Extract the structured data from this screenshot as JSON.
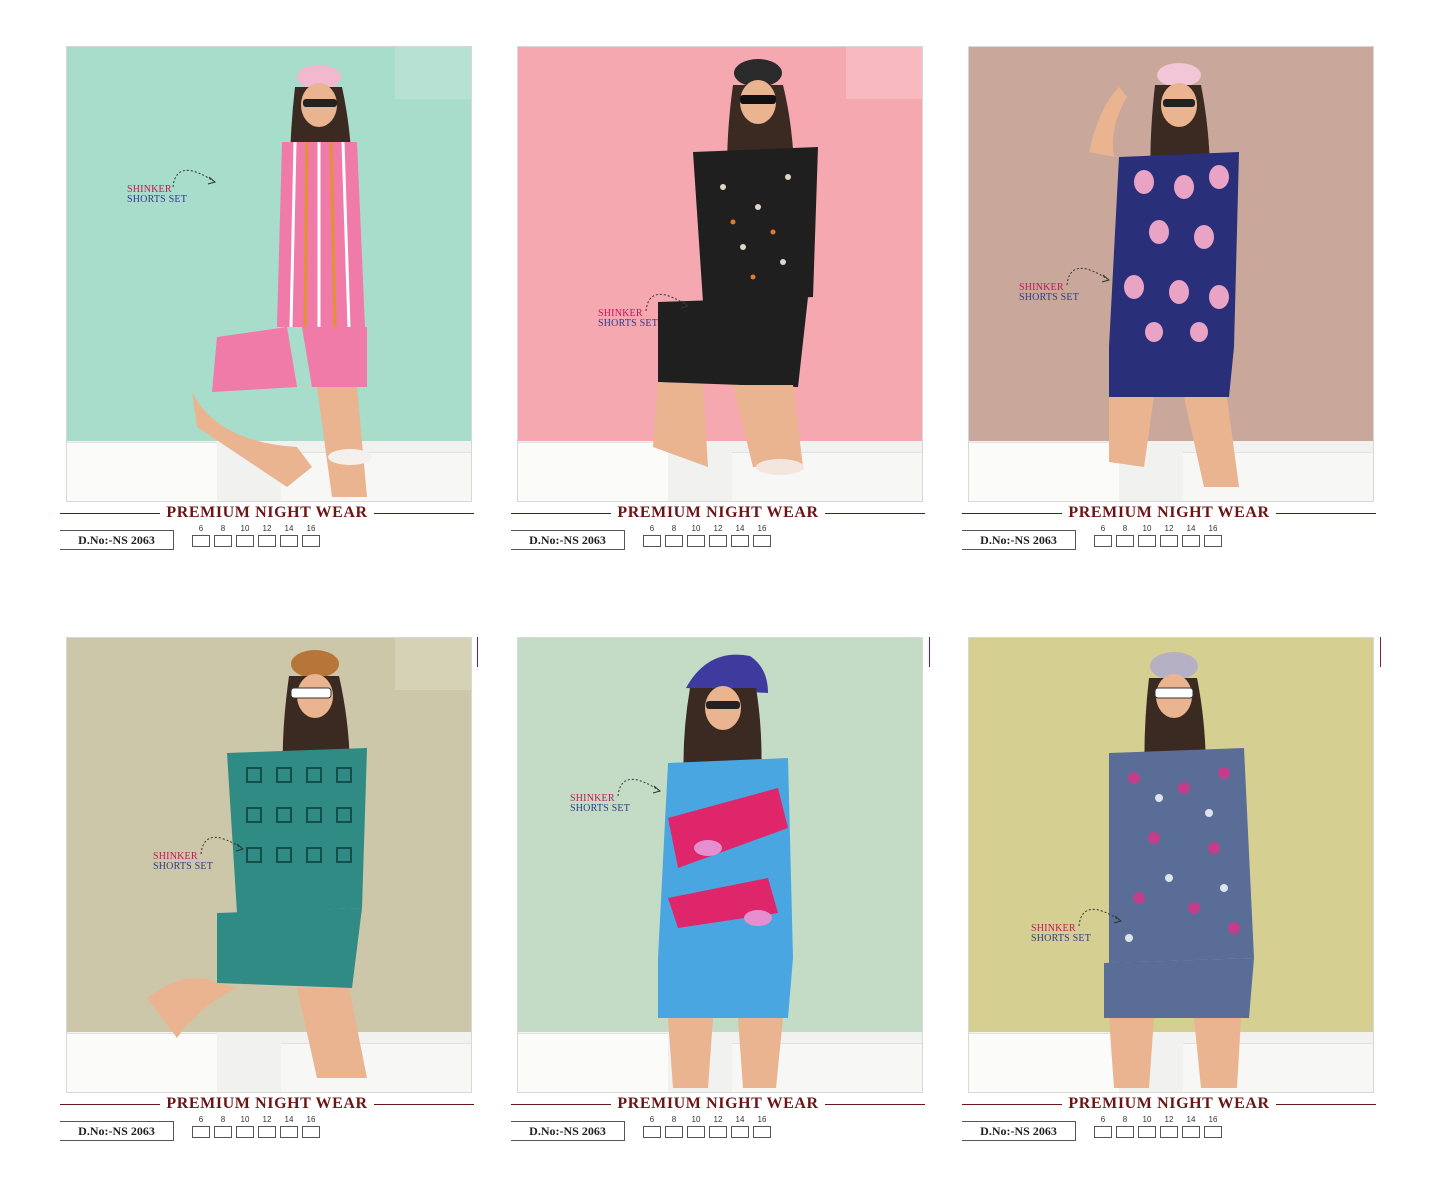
{
  "cards": [
    {
      "banner": "PREMIUM NIGHT WEAR",
      "design_no": "D.No:-NS 2063",
      "callout": {
        "line1": "SHINKER",
        "line2": "SHORTS SET"
      },
      "sizes": [
        "6",
        "8",
        "10",
        "12",
        "14",
        "16"
      ],
      "bg": "#a8dccb",
      "outfit": "#f07aa8"
    },
    {
      "banner": "PREMIUM NIGHT WEAR",
      "design_no": "D.No:-NS 2063",
      "callout": {
        "line1": "SHINKER",
        "line2": "SHORTS SET"
      },
      "sizes": [
        "6",
        "8",
        "10",
        "12",
        "14",
        "16"
      ],
      "bg": "#f5a8b0",
      "outfit": "#1f1f1f"
    },
    {
      "banner": "PREMIUM NIGHT WEAR",
      "design_no": "D.No:-NS 2063",
      "callout": {
        "line1": "SHINKER",
        "line2": "SHORTS SET"
      },
      "sizes": [
        "6",
        "8",
        "10",
        "12",
        "14",
        "16"
      ],
      "bg": "#c9a79a",
      "outfit": "#2a2f7a"
    },
    {
      "banner": "PREMIUM NIGHT WEAR",
      "design_no": "D.No:-NS 2063",
      "callout": {
        "line1": "SHINKER",
        "line2": "SHORTS SET"
      },
      "sizes": [
        "6",
        "8",
        "10",
        "12",
        "14",
        "16"
      ],
      "bg": "#ccc7a8",
      "outfit": "#2f8b84"
    },
    {
      "banner": "PREMIUM NIGHT WEAR",
      "design_no": "D.No:-NS 2063",
      "callout": {
        "line1": "SHINKER",
        "line2": "SHORTS SET"
      },
      "sizes": [
        "6",
        "8",
        "10",
        "12",
        "14",
        "16"
      ],
      "bg": "#c4dcc6",
      "outfit": "#4aa6e0"
    },
    {
      "banner": "PREMIUM NIGHT WEAR",
      "design_no": "D.No:-NS 2063",
      "callout": {
        "line1": "SHINKER",
        "line2": "SHORTS SET"
      },
      "sizes": [
        "6",
        "8",
        "10",
        "12",
        "14",
        "16"
      ],
      "bg": "#d5cf92",
      "outfit": "#5a6d96"
    }
  ]
}
